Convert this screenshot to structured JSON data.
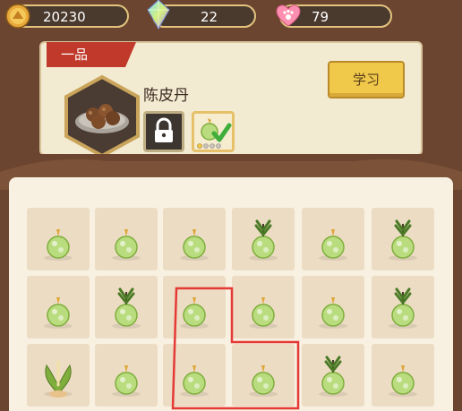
{
  "resources": {
    "gold": {
      "value": "20230",
      "icon": "gold-coin-icon"
    },
    "gems": {
      "value": "22",
      "icon": "crystal-gem-icon"
    },
    "hearts": {
      "value": "79",
      "icon": "paw-heart-icon"
    }
  },
  "recipe": {
    "rank_label": "一品",
    "name": "陈皮丹",
    "learn_button": "学习",
    "dish_icon": "pill-dish-icon",
    "slots": [
      {
        "type": "locked",
        "icon": "lock-icon"
      },
      {
        "type": "ingredient",
        "icon": "herb-check-icon",
        "stars": 1,
        "max_stars": 4
      }
    ]
  },
  "board": {
    "rows": [
      [
        "seed",
        "seed",
        "seed",
        "sprout",
        "seed",
        "sprout"
      ],
      [
        "seed",
        "sprout",
        "seed",
        "seed",
        "seed",
        "sprout"
      ],
      [
        "plant",
        "seed",
        "seed",
        "seed",
        "sprout",
        "seed"
      ]
    ],
    "selection": {
      "color": "#e53935",
      "cells": [
        [
          1,
          2
        ],
        [
          2,
          2
        ],
        [
          2,
          3
        ]
      ]
    }
  },
  "colors": {
    "frame": "#6b4530",
    "tile": "#ecdcc3",
    "rank_banner": "#c0392b",
    "button": "#f0c94b"
  }
}
